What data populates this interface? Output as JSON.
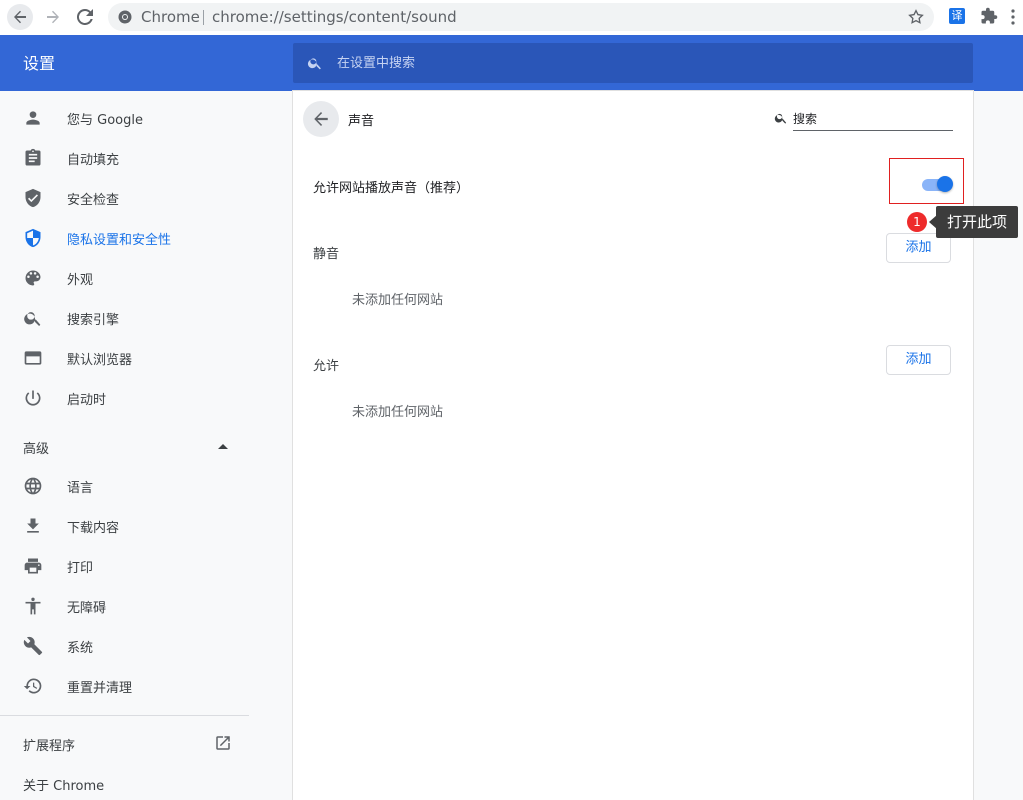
{
  "browser": {
    "site_name": "Chrome",
    "url": "chrome://settings/content/sound",
    "translate_ext_label": "译"
  },
  "header": {
    "title": "设置",
    "search_placeholder": "在设置中搜索"
  },
  "sidebar": {
    "items": [
      {
        "label": "您与 Google",
        "icon": "person-icon"
      },
      {
        "label": "自动填充",
        "icon": "clipboard-icon"
      },
      {
        "label": "安全检查",
        "icon": "shield-check-icon"
      },
      {
        "label": "隐私设置和安全性",
        "icon": "privacy-shield-icon",
        "active": true
      },
      {
        "label": "外观",
        "icon": "palette-icon"
      },
      {
        "label": "搜索引擎",
        "icon": "search-icon"
      },
      {
        "label": "默认浏览器",
        "icon": "browser-window-icon"
      },
      {
        "label": "启动时",
        "icon": "power-icon"
      }
    ],
    "advanced_label": "高级",
    "advanced_items": [
      {
        "label": "语言",
        "icon": "globe-icon"
      },
      {
        "label": "下载内容",
        "icon": "download-icon"
      },
      {
        "label": "打印",
        "icon": "printer-icon"
      },
      {
        "label": "无障碍",
        "icon": "accessibility-icon"
      },
      {
        "label": "系统",
        "icon": "wrench-icon"
      },
      {
        "label": "重置并清理",
        "icon": "history-icon"
      }
    ],
    "extensions_label": "扩展程序",
    "about_label": "关于 Chrome"
  },
  "main": {
    "title": "声音",
    "search_placeholder": "搜索",
    "allow_sound_label": "允许网站播放声音（推荐）",
    "allow_sound_enabled": true,
    "mute_section": {
      "label": "静音",
      "add_label": "添加",
      "empty_text": "未添加任何网站"
    },
    "allow_section": {
      "label": "允许",
      "add_label": "添加",
      "empty_text": "未添加任何网站"
    }
  },
  "annotation": {
    "badge_number": "1",
    "tooltip_text": "打开此项",
    "highlight_color": "#e02020"
  },
  "colors": {
    "accent": "#1a73e8",
    "header_bg": "#3367d6"
  }
}
